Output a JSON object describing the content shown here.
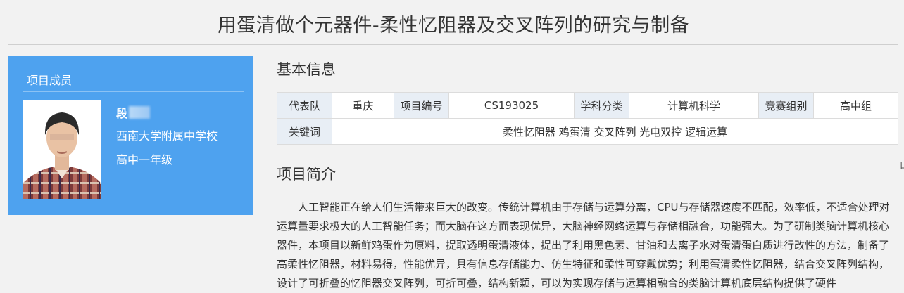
{
  "page": {
    "title": "用蛋清做个元器件-柔性忆阻器及交叉阵列的研究与制备"
  },
  "member_panel": {
    "title": "项目成员",
    "member": {
      "name": "段",
      "school": "西南大学附属中学校",
      "grade": "高中一年级"
    }
  },
  "basic_info": {
    "title": "基本信息",
    "row1": {
      "team_label": "代表队",
      "team_value": "重庆",
      "id_label": "项目编号",
      "id_value": "CS193025",
      "subject_label": "学科分类",
      "subject_value": "计算机科学",
      "group_label": "竞赛组别",
      "group_value": "高中组"
    },
    "row2": {
      "keywords_label": "关键词",
      "keywords_value": "柔性忆阻器 鸡蛋清 交叉阵列 光电双控 逻辑运算"
    }
  },
  "intro": {
    "title": "项目简介",
    "text": "人工智能正在给人们生活带来巨大的改变。传统计算机由于存储与运算分离，CPU与存储器速度不匹配，效率低，不适合处理对运算量要求极大的人工智能任务；而大脑在这方面表现优异，大脑神经网络运算与存储相融合，功能强大。为了研制类脑计算机核心器件，本项目以新鲜鸡蛋作为原料，提取透明蛋清液体，提出了利用黑色素、甘油和去离子水对蛋清蛋白质进行改性的方法，制备了高柔性忆阻器，材料易得，性能优异，具有信息存储能力、仿生特征和柔性可穿戴优势；利用蛋清柔性忆阻器，结合交叉阵列结构，设计了可折叠的忆阻器交叉阵列，可折可叠，结构新颖，可以为实现存储与运算相融合的类脑计算机底层结构提供了硬件"
  },
  "edge_mark": "口",
  "colors": {
    "panel_bg": "#4ea2ef",
    "label_cell_bg": "#e8eef5",
    "page_bg": "#f2f2f2"
  }
}
